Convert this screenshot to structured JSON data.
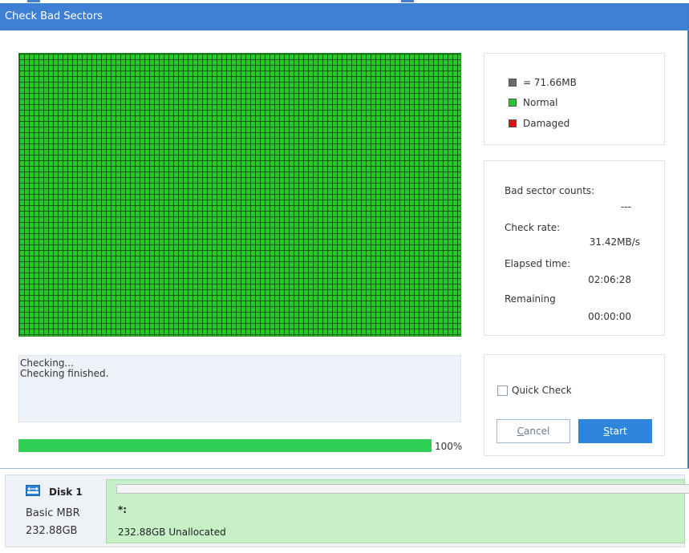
{
  "window": {
    "title": "Check Bad Sectors"
  },
  "legend": {
    "block_size": "= 71.66MB",
    "normal": "Normal",
    "damaged": "Damaged",
    "colors": {
      "block": "#6b6b6b",
      "normal": "#22cc22",
      "damaged": "#dd1111"
    }
  },
  "stats": {
    "bad_sector_label": "Bad sector counts:",
    "bad_sector_value": "---",
    "check_rate_label": "Check rate:",
    "check_rate_value": "31.42MB/s",
    "elapsed_label": "Elapsed time:",
    "elapsed_value": "02:06:28",
    "remaining_label": "Remaining",
    "remaining_value": "00:00:00"
  },
  "log": {
    "lines": [
      "Checking...",
      "Checking finished."
    ]
  },
  "progress": {
    "value": 1.0,
    "label": "100%"
  },
  "options": {
    "quick_check_label": "Quick Check",
    "quick_check_checked": false
  },
  "buttons": {
    "cancel_label": "Cancel",
    "start_label": "Start"
  },
  "disk": {
    "name": "Disk 1",
    "type": "Basic MBR",
    "size": "232.88GB",
    "icon": "disk-icon",
    "partition": {
      "name": "*:",
      "description": "232.88GB Unallocated"
    }
  },
  "colors": {
    "accent": "#3d80d4",
    "grid_fill": "#1fcf1f",
    "progress_fill": "#2fcf56",
    "partition_fill": "#c7f0c7"
  }
}
